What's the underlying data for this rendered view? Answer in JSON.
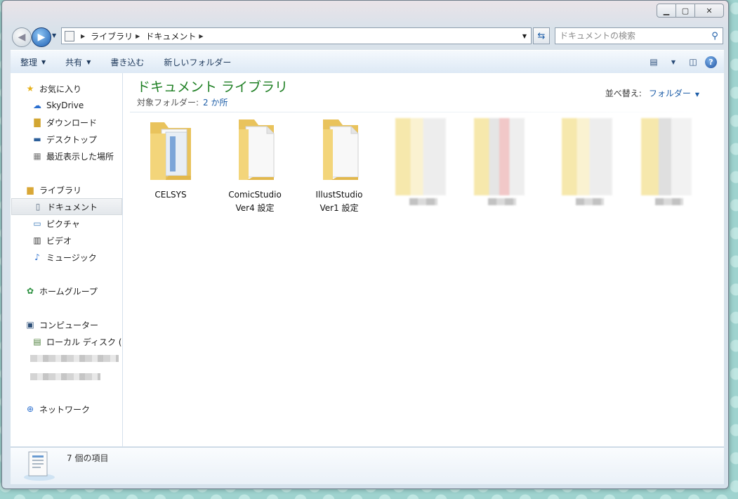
{
  "address": {
    "crumbs": [
      "ライブラリ",
      "ドキュメント"
    ]
  },
  "search": {
    "placeholder": "ドキュメントの検索"
  },
  "toolbar": {
    "organize": "整理",
    "share": "共有",
    "burn": "書き込む",
    "new_folder": "新しいフォルダー"
  },
  "navpane": {
    "favorites": "お気に入り",
    "skydrive": "SkyDrive",
    "downloads": "ダウンロード",
    "desktop": "デスクトップ",
    "recent": "最近表示した場所",
    "libraries": "ライブラリ",
    "documents": "ドキュメント",
    "pictures": "ピクチャ",
    "videos": "ビデオ",
    "music": "ミュージック",
    "homegroup": "ホームグループ",
    "computer": "コンピューター",
    "local_disk": "ローカル ディスク (",
    "network": "ネットワーク"
  },
  "content": {
    "title": "ドキュメント ライブラリ",
    "subtitle_prefix": "対象フォルダー:",
    "subtitle_link": "2 か所",
    "sort_label": "並べ替え:",
    "sort_value": "フォルダー",
    "files": [
      {
        "line1": "CELSYS",
        "line2": ""
      },
      {
        "line1": "ComicStudio",
        "line2": "Ver4 設定"
      },
      {
        "line1": "IllustStudio",
        "line2": "Ver1 設定"
      }
    ]
  },
  "details": {
    "count": "7 個の項目"
  },
  "colors": {
    "accent": "#1e5ea8",
    "title_green": "#1e7f23",
    "folder": "#f3d57a"
  }
}
